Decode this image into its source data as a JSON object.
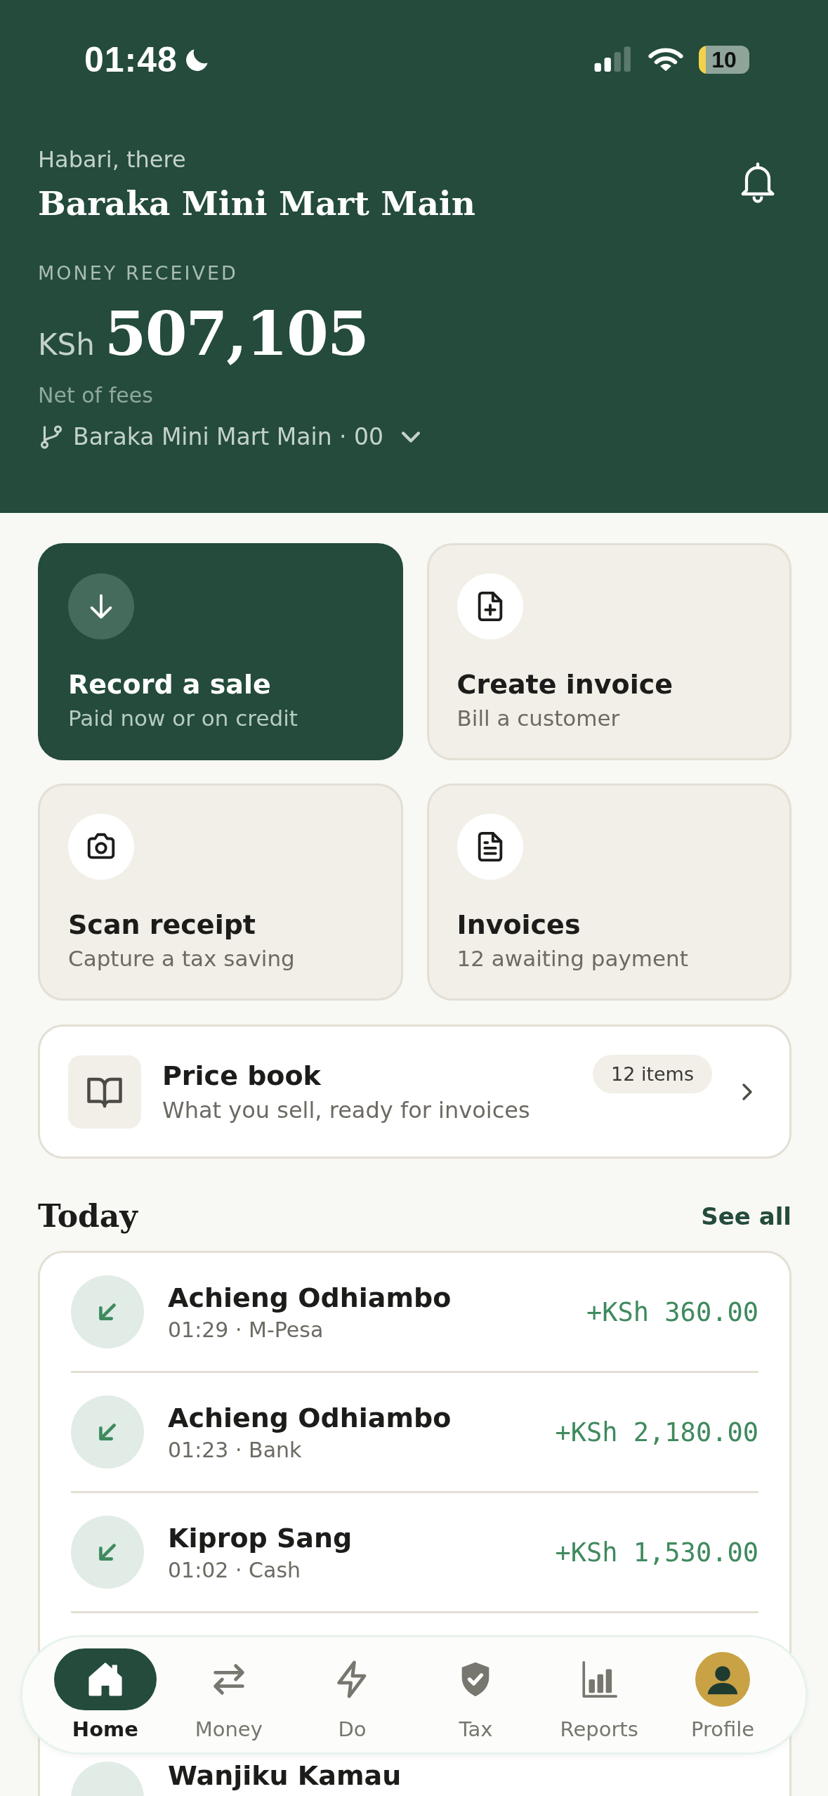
{
  "status_bar": {
    "time": "01:48",
    "battery": "10"
  },
  "header": {
    "greeting": "Habari, there",
    "business": "Baraka Mini Mart Main",
    "label": "MONEY RECEIVED",
    "currency": "KSh",
    "amount": "507,105",
    "note": "Net of fees",
    "branch": "Baraka Mini Mart Main · 00"
  },
  "actions": [
    {
      "kind": "primary",
      "title": "Record a sale",
      "subtitle": "Paid now or on credit"
    },
    {
      "kind": "secondary",
      "title": "Create invoice",
      "subtitle": "Bill a customer"
    },
    {
      "kind": "secondary",
      "title": "Scan receipt",
      "subtitle": "Capture a tax saving"
    },
    {
      "kind": "secondary",
      "title": "Invoices",
      "subtitle": "12 awaiting payment"
    }
  ],
  "price_book": {
    "title": "Price book",
    "subtitle": "What you sell, ready for invoices",
    "badge": "12 items"
  },
  "today": {
    "title": "Today",
    "link": "See all",
    "transactions": [
      {
        "name": "Achieng Odhiambo",
        "meta": "01:29 · M-Pesa",
        "amount": "+KSh 360.00"
      },
      {
        "name": "Achieng Odhiambo",
        "meta": "01:23 · Bank",
        "amount": "+KSh 2,180.00"
      },
      {
        "name": "Kiprop Sang",
        "meta": "01:02 · Cash",
        "amount": "+KSh 1,530.00"
      }
    ],
    "partial_row": {
      "name": "Wanjiku Kamau"
    }
  },
  "nav": [
    {
      "label": "Home",
      "selected": true
    },
    {
      "label": "Money",
      "selected": false
    },
    {
      "label": "Do",
      "selected": false
    },
    {
      "label": "Tax",
      "selected": false
    },
    {
      "label": "Reports",
      "selected": false
    },
    {
      "label": "Profile",
      "selected": false
    }
  ]
}
